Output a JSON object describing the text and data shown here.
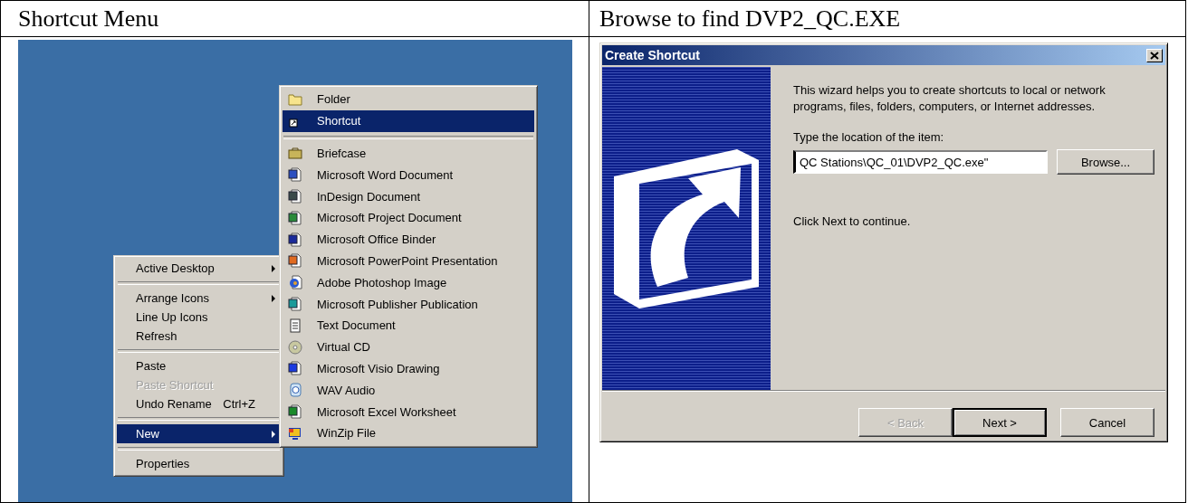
{
  "table": {
    "headers": [
      "Shortcut Menu",
      "Browse to find DVP2_QC.EXE"
    ]
  },
  "context_menu": {
    "items": [
      {
        "kind": "item",
        "label": "Active Desktop",
        "submenu": true,
        "selected": false,
        "disabled": false
      },
      {
        "kind": "separator"
      },
      {
        "kind": "item",
        "label": "Arrange Icons",
        "submenu": true,
        "selected": false,
        "disabled": false
      },
      {
        "kind": "item",
        "label": "Line Up Icons",
        "submenu": false,
        "selected": false,
        "disabled": false
      },
      {
        "kind": "item",
        "label": "Refresh",
        "submenu": false,
        "selected": false,
        "disabled": false
      },
      {
        "kind": "separator"
      },
      {
        "kind": "item",
        "label": "Paste",
        "submenu": false,
        "selected": false,
        "disabled": false
      },
      {
        "kind": "item",
        "label": "Paste Shortcut",
        "submenu": false,
        "selected": false,
        "disabled": true
      },
      {
        "kind": "item",
        "label": "Undo Rename",
        "shortcut": "Ctrl+Z",
        "submenu": false,
        "selected": false,
        "disabled": false
      },
      {
        "kind": "separator"
      },
      {
        "kind": "item",
        "label": "New",
        "submenu": true,
        "selected": true,
        "disabled": false
      },
      {
        "kind": "separator"
      },
      {
        "kind": "item",
        "label": "Properties",
        "submenu": false,
        "selected": false,
        "disabled": false
      }
    ]
  },
  "new_submenu": {
    "items": [
      {
        "kind": "item",
        "label": "Folder",
        "selected": false
      },
      {
        "kind": "item",
        "label": "Shortcut",
        "selected": true
      },
      {
        "kind": "separator"
      },
      {
        "kind": "item",
        "label": "Briefcase",
        "selected": false
      },
      {
        "kind": "item",
        "label": "Microsoft Word Document",
        "selected": false
      },
      {
        "kind": "item",
        "label": "InDesign Document",
        "selected": false
      },
      {
        "kind": "item",
        "label": "Microsoft Project Document",
        "selected": false
      },
      {
        "kind": "item",
        "label": "Microsoft Office Binder",
        "selected": false
      },
      {
        "kind": "item",
        "label": "Microsoft PowerPoint Presentation",
        "selected": false
      },
      {
        "kind": "item",
        "label": "Adobe Photoshop Image",
        "selected": false
      },
      {
        "kind": "item",
        "label": "Microsoft Publisher Publication",
        "selected": false
      },
      {
        "kind": "item",
        "label": "Text Document",
        "selected": false
      },
      {
        "kind": "item",
        "label": "Virtual CD",
        "selected": false
      },
      {
        "kind": "item",
        "label": "Microsoft Visio Drawing",
        "selected": false
      },
      {
        "kind": "item",
        "label": "WAV Audio",
        "selected": false
      },
      {
        "kind": "item",
        "label": "Microsoft Excel Worksheet",
        "selected": false
      },
      {
        "kind": "item",
        "label": "WinZip File",
        "selected": false
      }
    ]
  },
  "dialog": {
    "title": "Create Shortcut",
    "description": "This wizard helps you to create shortcuts to local or network programs, files, folders, computers, or Internet addresses.",
    "field_label": "Type the location of the item:",
    "field_value": "QC Stations\\QC_01\\DVP2_QC.exe\"",
    "field_focused": true,
    "browse_button": "Browse...",
    "instruction": "Click Next to continue.",
    "buttons": [
      {
        "label": "< Back",
        "disabled": true,
        "default": false
      },
      {
        "label": "Next >",
        "disabled": false,
        "default": true
      },
      {
        "label": "Cancel",
        "disabled": false,
        "default": false
      }
    ]
  }
}
